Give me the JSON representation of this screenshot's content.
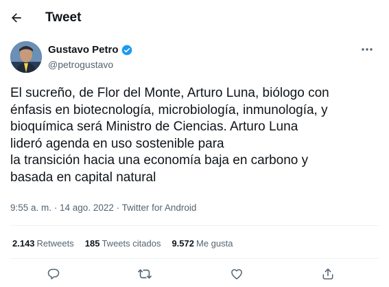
{
  "header": {
    "title": "Tweet",
    "back_icon": "arrow-left-icon"
  },
  "author": {
    "name": "Gustavo Petro",
    "handle": "@petrogustavo",
    "verified_icon": "verified-badge-icon",
    "verified_color": "#1d9bf0"
  },
  "tweet": {
    "lines": [
      "El sucreño, de Flor del Monte, Arturo Luna, biólogo con",
      "énfasis en biotecnología, microbiología, inmunología, y",
      "bioquímica será Ministro de Ciencias. Arturo Luna",
      "lideró agenda en uso sostenible para",
      "la transición hacia una economía baja en carbono y",
      "basada en capital natural"
    ],
    "meta": "9:55 a. m. · 14 ago. 2022 · Twitter for Android"
  },
  "stats": {
    "retweets_count": "2.143",
    "retweets_label": "Retweets",
    "quotes_count": "185",
    "quotes_label": "Tweets citados",
    "likes_count": "9.572",
    "likes_label": "Me gusta"
  },
  "actions": [
    "reply-icon",
    "retweet-icon",
    "like-icon",
    "share-icon"
  ],
  "colors": {
    "text": "#0f1419",
    "secondary": "#536471",
    "divider": "#eff3f4",
    "accent": "#1d9bf0"
  }
}
